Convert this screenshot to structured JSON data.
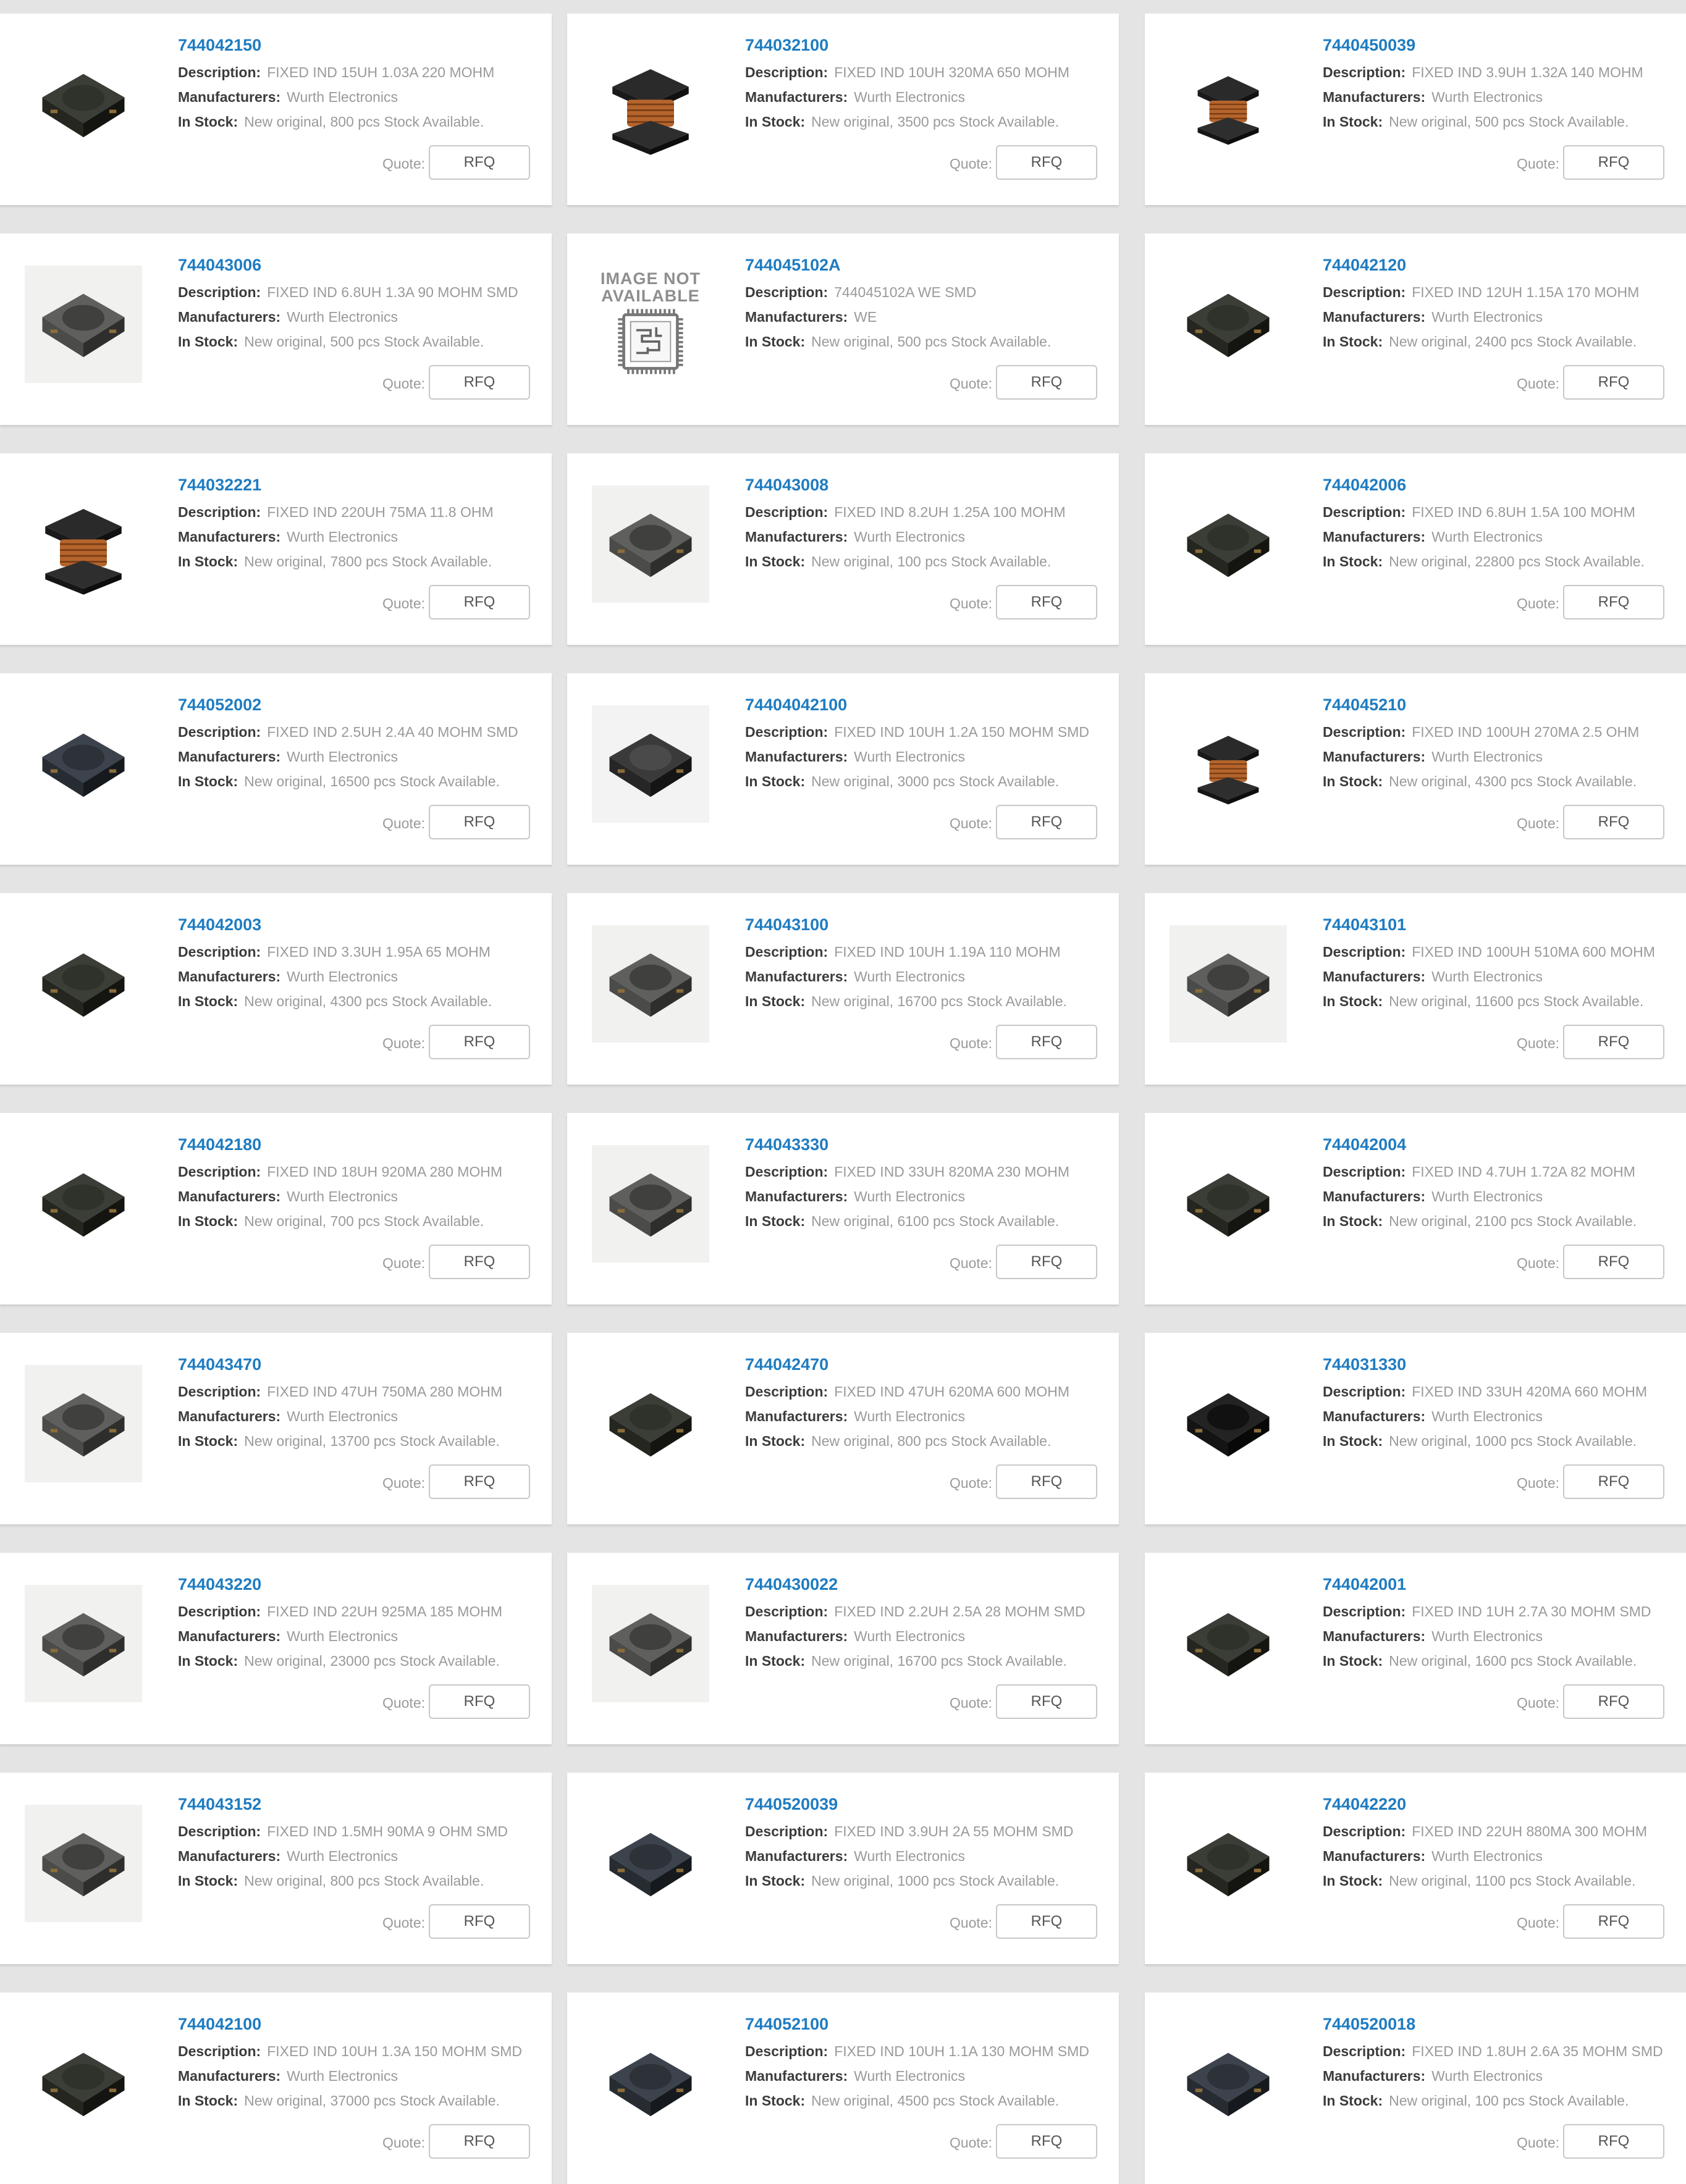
{
  "labels": {
    "description": "Description:",
    "manufacturers": "Manufacturers:",
    "in_stock": "In Stock:",
    "quote": "Quote:",
    "rfq": "RFQ",
    "image_not_available": "IMAGE NOT AVAILABLE"
  },
  "colors": {
    "page_bg": "#e4e4e4",
    "card_bg": "#ffffff",
    "link": "#1f7cc1",
    "label": "#3c3c3c",
    "value": "#9a9a9a"
  },
  "products": [
    {
      "part": "744042150",
      "description": "FIXED IND 15UH 1.03A 220 MOHM",
      "manufacturer": "Wurth Electronics",
      "stock": "New original, 800 pcs Stock Available.",
      "image": "shielded-inductor-dark-icon"
    },
    {
      "part": "744032100",
      "description": "FIXED IND 10UH 320MA 650 MOHM",
      "manufacturer": "Wurth Electronics",
      "stock": "New original, 3500 pcs Stock Available.",
      "image": "wirewound-inductor-large-icon"
    },
    {
      "part": "7440450039",
      "description": "FIXED IND 3.9UH 1.32A 140 MOHM",
      "manufacturer": "Wurth Electronics",
      "stock": "New original, 500 pcs Stock Available.",
      "image": "wirewound-inductor-small-icon"
    },
    {
      "part": "744043006",
      "description": "FIXED IND 6.8UH 1.3A 90 MOHM SMD",
      "manufacturer": "Wurth Electronics",
      "stock": "New original, 500 pcs Stock Available.",
      "image": "shielded-inductor-gray-icon"
    },
    {
      "part": "744045102A",
      "description": "744045102A WE SMD",
      "manufacturer": "WE",
      "stock": "New original, 500 pcs Stock Available.",
      "image": "image-not-available-icon"
    },
    {
      "part": "744042120",
      "description": "FIXED IND 12UH 1.15A 170 MOHM",
      "manufacturer": "Wurth Electronics",
      "stock": "New original, 2400 pcs Stock Available.",
      "image": "shielded-inductor-dark-icon"
    },
    {
      "part": "744032221",
      "description": "FIXED IND 220UH 75MA 11.8 OHM",
      "manufacturer": "Wurth Electronics",
      "stock": "New original, 7800 pcs Stock Available.",
      "image": "wirewound-inductor-large-icon"
    },
    {
      "part": "744043008",
      "description": "FIXED IND 8.2UH 1.25A 100 MOHM",
      "manufacturer": "Wurth Electronics",
      "stock": "New original, 100 pcs Stock Available.",
      "image": "shielded-inductor-gray-icon"
    },
    {
      "part": "744042006",
      "description": "FIXED IND 6.8UH 1.5A 100 MOHM",
      "manufacturer": "Wurth Electronics",
      "stock": "New original, 22800 pcs Stock Available.",
      "image": "shielded-inductor-dark-icon"
    },
    {
      "part": "744052002",
      "description": "FIXED IND 2.5UH 2.4A 40 MOHM SMD",
      "manufacturer": "Wurth Electronics",
      "stock": "New original, 16500 pcs Stock Available.",
      "image": "shielded-inductor-slate-icon"
    },
    {
      "part": "74404042100",
      "description": "FIXED IND 10UH 1.2A 150 MOHM SMD",
      "manufacturer": "Wurth Electronics",
      "stock": "New original, 3000 pcs Stock Available.",
      "image": "shielded-inductor-charcoal-icon"
    },
    {
      "part": "744045210",
      "description": "FIXED IND 100UH 270MA 2.5 OHM",
      "manufacturer": "Wurth Electronics",
      "stock": "New original, 4300 pcs Stock Available.",
      "image": "wirewound-inductor-small-icon"
    },
    {
      "part": "744042003",
      "description": "FIXED IND 3.3UH 1.95A 65 MOHM",
      "manufacturer": "Wurth Electronics",
      "stock": "New original, 4300 pcs Stock Available.",
      "image": "shielded-inductor-dark-icon"
    },
    {
      "part": "744043100",
      "description": "FIXED IND 10UH 1.19A 110 MOHM",
      "manufacturer": "Wurth Electronics",
      "stock": "New original, 16700 pcs Stock Available.",
      "image": "shielded-inductor-gray-icon"
    },
    {
      "part": "744043101",
      "description": "FIXED IND 100UH 510MA 600 MOHM",
      "manufacturer": "Wurth Electronics",
      "stock": "New original, 11600 pcs Stock Available.",
      "image": "shielded-inductor-gray-icon"
    },
    {
      "part": "744042180",
      "description": "FIXED IND 18UH 920MA 280 MOHM",
      "manufacturer": "Wurth Electronics",
      "stock": "New original, 700 pcs Stock Available.",
      "image": "shielded-inductor-dark-icon"
    },
    {
      "part": "744043330",
      "description": "FIXED IND 33UH 820MA 230 MOHM",
      "manufacturer": "Wurth Electronics",
      "stock": "New original, 6100 pcs Stock Available.",
      "image": "shielded-inductor-gray-icon"
    },
    {
      "part": "744042004",
      "description": "FIXED IND 4.7UH 1.72A 82 MOHM",
      "manufacturer": "Wurth Electronics",
      "stock": "New original, 2100 pcs Stock Available.",
      "image": "shielded-inductor-dark-icon"
    },
    {
      "part": "744043470",
      "description": "FIXED IND 47UH 750MA 280 MOHM",
      "manufacturer": "Wurth Electronics",
      "stock": "New original, 13700 pcs Stock Available.",
      "image": "shielded-inductor-gray-icon"
    },
    {
      "part": "744042470",
      "description": "FIXED IND 47UH 620MA 600 MOHM",
      "manufacturer": "Wurth Electronics",
      "stock": "New original, 800 pcs Stock Available.",
      "image": "shielded-inductor-dark-icon"
    },
    {
      "part": "744031330",
      "description": "FIXED IND 33UH 420MA 660 MOHM",
      "manufacturer": "Wurth Electronics",
      "stock": "New original, 1000 pcs Stock Available.",
      "image": "shielded-inductor-black-icon"
    },
    {
      "part": "744043220",
      "description": "FIXED IND 22UH 925MA 185 MOHM",
      "manufacturer": "Wurth Electronics",
      "stock": "New original, 23000 pcs Stock Available.",
      "image": "shielded-inductor-gray-icon"
    },
    {
      "part": "7440430022",
      "description": "FIXED IND 2.2UH 2.5A 28 MOHM SMD",
      "manufacturer": "Wurth Electronics",
      "stock": "New original, 16700 pcs Stock Available.",
      "image": "shielded-inductor-gray-icon"
    },
    {
      "part": "744042001",
      "description": "FIXED IND 1UH 2.7A 30 MOHM SMD",
      "manufacturer": "Wurth Electronics",
      "stock": "New original, 1600 pcs Stock Available.",
      "image": "shielded-inductor-dark-icon"
    },
    {
      "part": "744043152",
      "description": "FIXED IND 1.5MH 90MA 9 OHM SMD",
      "manufacturer": "Wurth Electronics",
      "stock": "New original, 800 pcs Stock Available.",
      "image": "shielded-inductor-gray-icon"
    },
    {
      "part": "7440520039",
      "description": "FIXED IND 3.9UH 2A 55 MOHM SMD",
      "manufacturer": "Wurth Electronics",
      "stock": "New original, 1000 pcs Stock Available.",
      "image": "shielded-inductor-slate-icon"
    },
    {
      "part": "744042220",
      "description": "FIXED IND 22UH 880MA 300 MOHM",
      "manufacturer": "Wurth Electronics",
      "stock": "New original, 1100 pcs Stock Available.",
      "image": "shielded-inductor-dark-icon"
    },
    {
      "part": "744042100",
      "description": "FIXED IND 10UH 1.3A 150 MOHM SMD",
      "manufacturer": "Wurth Electronics",
      "stock": "New original, 37000 pcs Stock Available.",
      "image": "shielded-inductor-dark-icon"
    },
    {
      "part": "744052100",
      "description": "FIXED IND 10UH 1.1A 130 MOHM SMD",
      "manufacturer": "Wurth Electronics",
      "stock": "New original, 4500 pcs Stock Available.",
      "image": "shielded-inductor-slate-icon"
    },
    {
      "part": "7440520018",
      "description": "FIXED IND 1.8UH 2.6A 35 MOHM SMD",
      "manufacturer": "Wurth Electronics",
      "stock": "New original, 100 pcs Stock Available.",
      "image": "shielded-inductor-slate-icon"
    }
  ]
}
